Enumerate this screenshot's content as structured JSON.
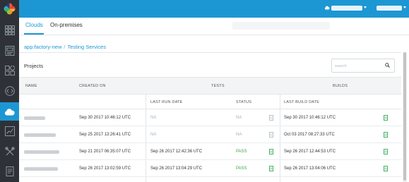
{
  "tabs": {
    "clouds": "Clouds",
    "on_premises": "On-premises"
  },
  "breadcrumb": {
    "root": "app:factory-new",
    "separator": "/",
    "current": "Testing Services"
  },
  "panel": {
    "title": "Projects",
    "search_placeholder": "search"
  },
  "table": {
    "headers": {
      "name": "NAME",
      "created_on": "CREATED ON",
      "tests": "TESTS",
      "builds": "BUILDS",
      "last_run_date": "LAST RUN DATE",
      "status": "STATUS",
      "last_build_date": "LAST BUILD DATE"
    },
    "rows": [
      {
        "created_on": "Sep 30 2017 10:46:12 UTC",
        "last_run_date": "NA",
        "status": "NA",
        "last_build_date": "Sep 30 2017 10:46:12 UTC"
      },
      {
        "created_on": "Sep 25 2017 13:26:41 UTC",
        "last_run_date": "NA",
        "status": "NA",
        "last_build_date": "Oct 03 2017 08:27:33 UTC"
      },
      {
        "created_on": "Sep 21 2017 06:35:07 UTC",
        "last_run_date": "Sep 26 2017 12:42:36 UTC",
        "status": "PASS",
        "last_build_date": "Sep 26 2017 12:44:53 UTC"
      },
      {
        "created_on": "Sep 26 2017 13:02:59 UTC",
        "last_run_date": "Sep 26 2017 13:04:29 UTC",
        "status": "PASS",
        "last_build_date": "Sep 26 2017 13:04:06 UTC"
      }
    ]
  },
  "colors": {
    "accent": "#1d97d4",
    "sidebar": "#2e3238",
    "pass": "#3aa656"
  },
  "icons": {
    "logo": "pinwheel-logo",
    "sidebar": [
      "grid-icon",
      "dashboard-icon",
      "components-icon",
      "code-icon",
      "cloud-icon",
      "analytics-icon",
      "tools-icon",
      "document-icon"
    ],
    "status": "report-icon",
    "build": "build-report-icon"
  }
}
